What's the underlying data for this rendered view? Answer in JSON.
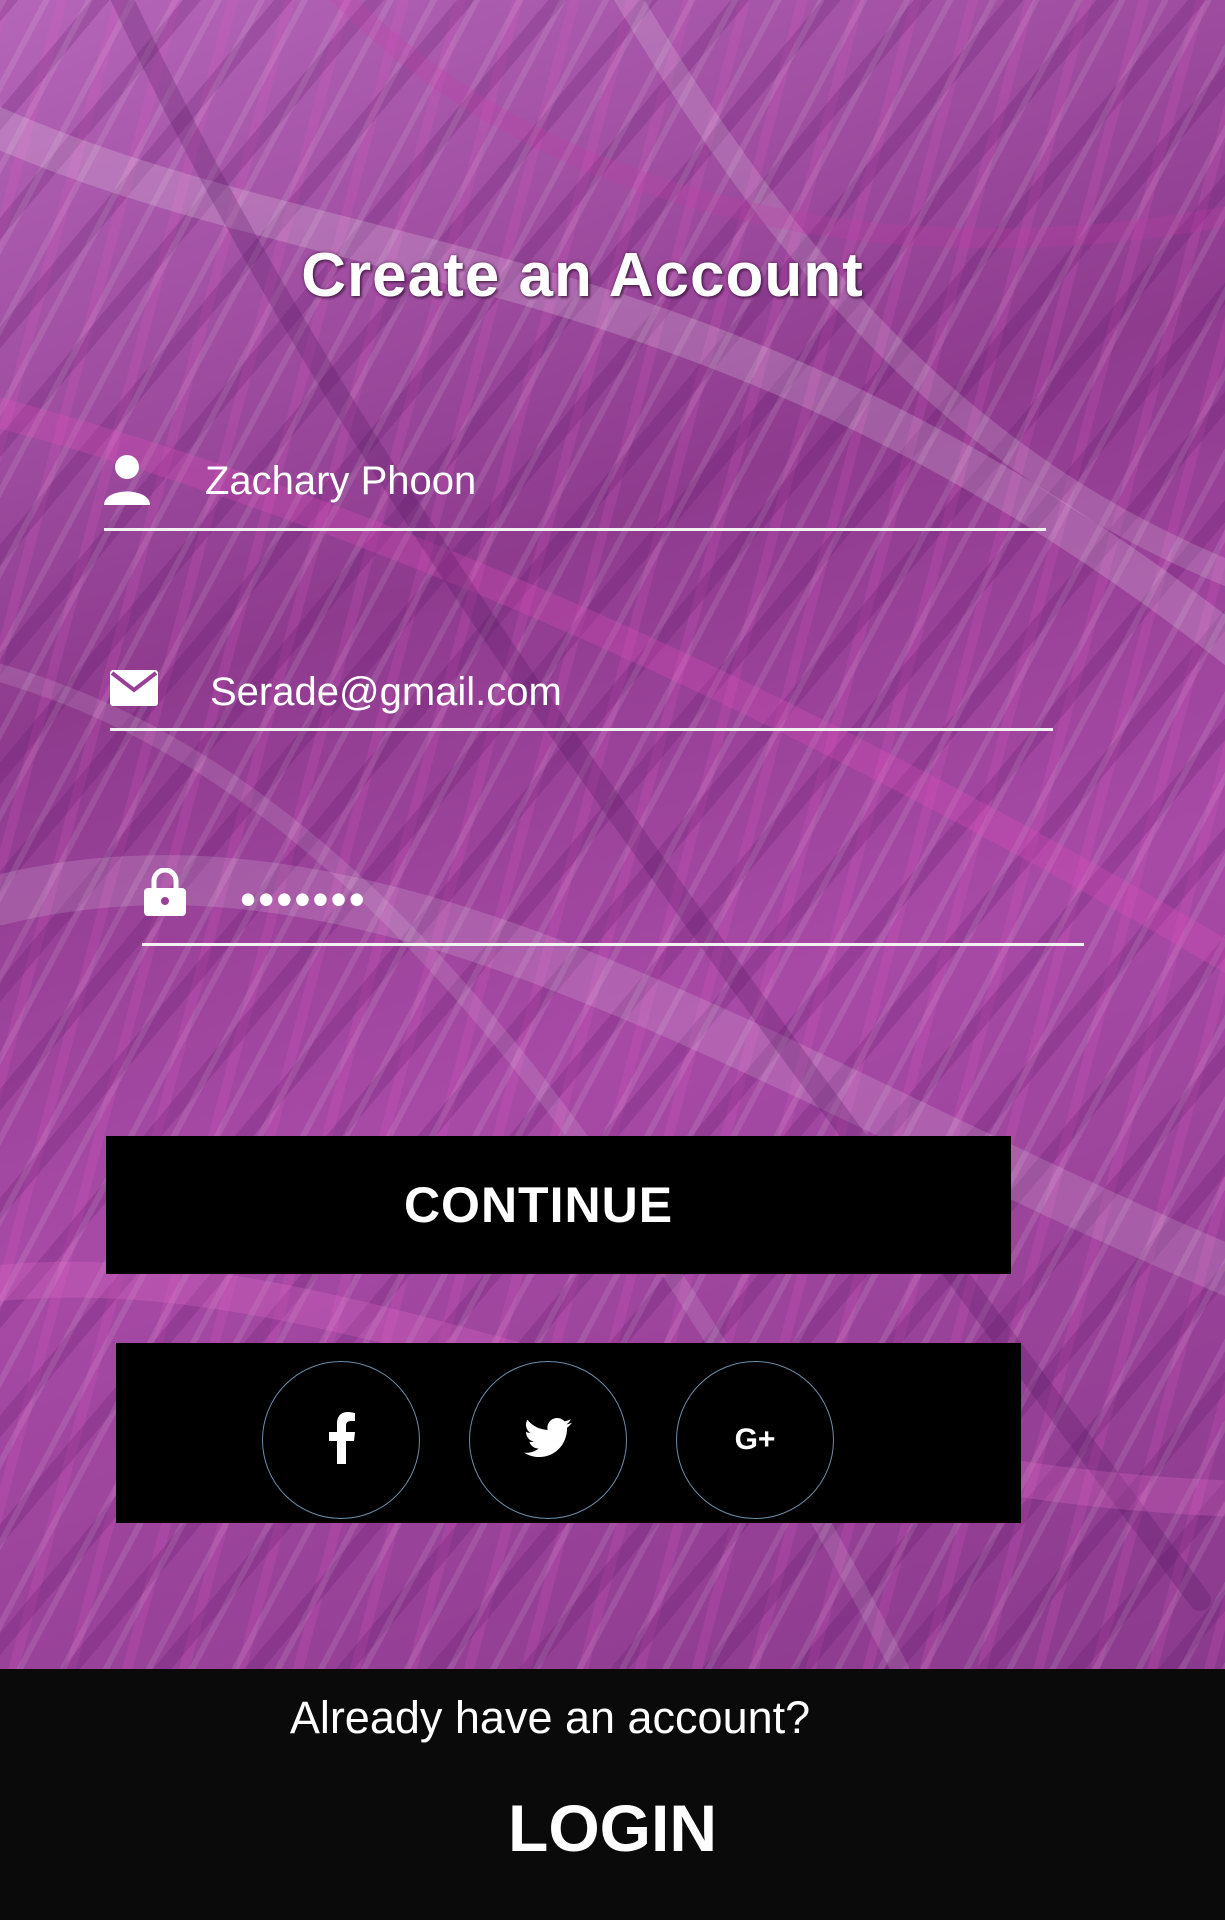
{
  "page": {
    "title": "Create an Account"
  },
  "form": {
    "name_value": "Zachary Phoon",
    "email_value": "Serade@gmail.com",
    "password_value": "•••••••"
  },
  "actions": {
    "continue_label": "CONTINUE"
  },
  "social": [
    {
      "icon": "facebook-icon",
      "label": "f"
    },
    {
      "icon": "twitter-icon",
      "label": ""
    },
    {
      "icon": "google-plus-icon",
      "label": "G+"
    }
  ],
  "footer": {
    "prompt": "Already have an account?",
    "login_label": "LOGIN"
  },
  "colors": {
    "background_accent": "#9a3f98",
    "button": "#000000",
    "footer": "#0a0a0a",
    "text": "#ffffff"
  }
}
